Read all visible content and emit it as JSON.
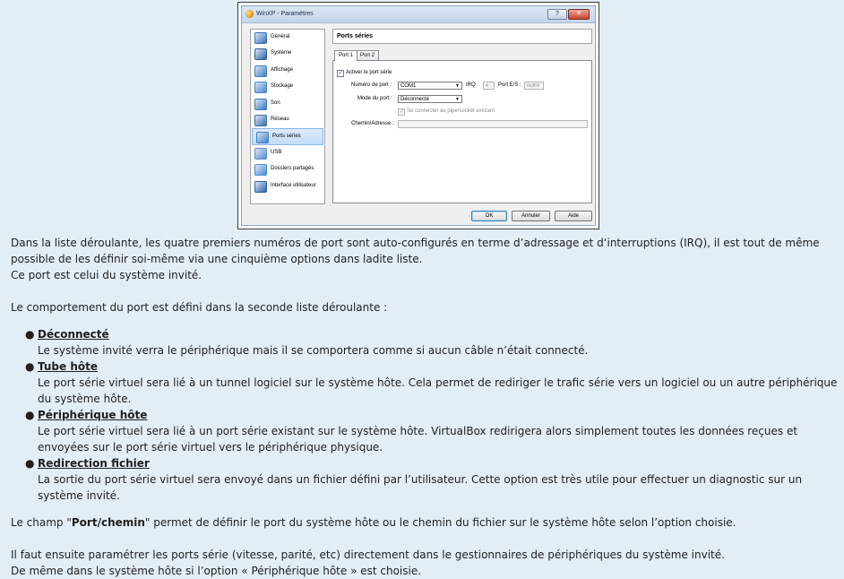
{
  "dialog": {
    "title": "WinXP - Paramètres",
    "help_btn": "?",
    "close_btn": "✕",
    "sidebar": [
      {
        "label": "Général",
        "icon": "general-icon",
        "color": "#3b6fb6"
      },
      {
        "label": "Système",
        "icon": "system-icon",
        "color": "#2d5fa5"
      },
      {
        "label": "Affichage",
        "icon": "display-icon",
        "color": "#3f7fc6"
      },
      {
        "label": "Stockage",
        "icon": "storage-icon",
        "color": "#4b86c9"
      },
      {
        "label": "Son",
        "icon": "sound-icon",
        "color": "#3a79c2"
      },
      {
        "label": "Réseau",
        "icon": "network-icon",
        "color": "#3c6ea8"
      },
      {
        "label": "Ports séries",
        "icon": "serial-port-icon",
        "color": "#3f80c8"
      },
      {
        "label": "USB",
        "icon": "usb-icon",
        "color": "#5d8ecb"
      },
      {
        "label": "Dossiers partagés",
        "icon": "shared-folder-icon",
        "color": "#4c8bd0"
      },
      {
        "label": "Interface utilisateur",
        "icon": "user-interface-icon",
        "color": "#2f61a8"
      }
    ],
    "selected_index": 6,
    "panel_title": "Ports séries",
    "tabs": [
      "Port 1",
      "Port 2"
    ],
    "active_tab": 0,
    "enable_port_label": "Activer le port série",
    "enable_port_checked": "✓",
    "port_number_label": "Numéro de port :",
    "port_number_value": "COM1",
    "irq_label": "IRQ :",
    "irq_value": "4",
    "io_port_label": "Port E/S :",
    "io_port_value": "0x3F8",
    "port_mode_label": "Mode du port :",
    "port_mode_value": "Déconnecté",
    "pipe_label": "Se connecter au pipe/socket existant",
    "pipe_checked": "✓",
    "path_label": "Chemin/Adresse :",
    "path_value": "",
    "ok": "OK",
    "cancel": "Annuler",
    "help": "Aide"
  },
  "article": {
    "p1_l1": "Dans la liste déroulante, les quatre premiers numéros de port sont auto-configurés en terme d’adressage et d‘interruptions (IRQ), il est tout de même",
    "p1_l2": "possible de les définir soi-même via une cinquième options dans ladite liste.",
    "p1_l3": "Ce port est celui du système invité.",
    "p2": "Le comportement du port est défini dans la seconde liste déroulante :",
    "bullets": [
      {
        "term": "Déconnecté",
        "lines": [
          "Le système invité verra le périphérique mais il se comportera comme si aucun câble n’était connecté."
        ]
      },
      {
        "term": "Tube hôte",
        "lines": [
          "Le port série virtuel sera lié à un tunnel logiciel sur le système hôte. Cela permet de rediriger le trafic série vers un logiciel ou un autre périphérique",
          "du système hôte."
        ]
      },
      {
        "term": "Périphérique hôte",
        "lines": [
          "Le port série virtuel sera lié à un port série existant sur le système hôte. VirtualBox redirigera alors simplement toutes les données reçues et",
          "envoyées sur le port série virtuel vers le périphérique physique."
        ]
      },
      {
        "term": "Redirection fichier",
        "lines": [
          "La sortie du port série virtuel sera envoyé dans un fichier défini par l’utilisateur. Cette option est très utile pour effectuer un diagnostic sur un",
          "système invité."
        ]
      }
    ],
    "p3_a": "Le champ \"",
    "p3_b": "Port/chemin",
    "p3_c": "\" permet de définir le port du système hôte ou le chemin du fichier sur le système hôte selon l’option choisie.",
    "p4_l1": "Il faut ensuite paramétrer les ports série (vitesse, parité, etc) directement dans le gestionnaires de périphériques du système invité.",
    "p4_l2": "De même dans le système hôte si l’option « Périphérique hôte » est choisie."
  }
}
